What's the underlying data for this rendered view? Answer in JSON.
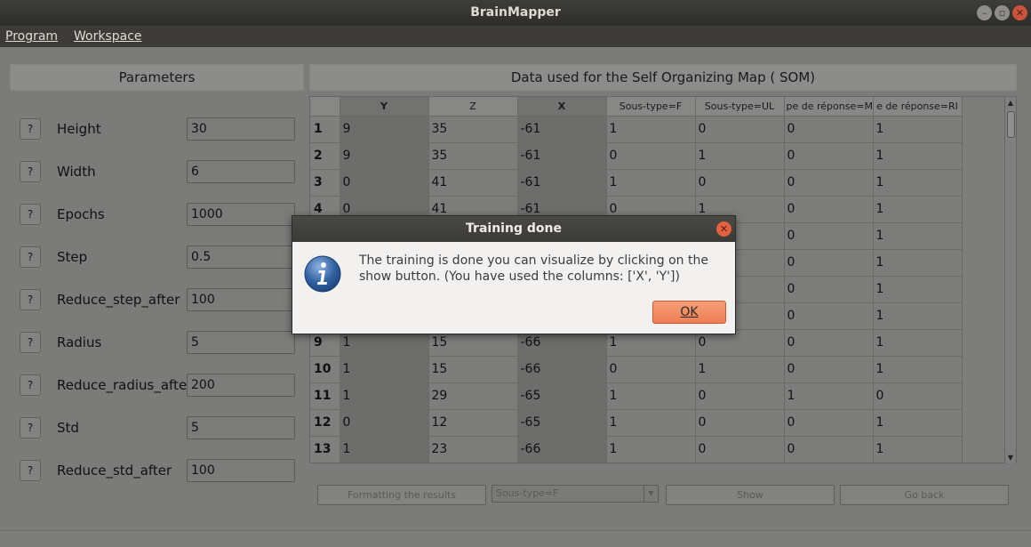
{
  "window": {
    "title": "BrainMapper"
  },
  "menu": {
    "program": "Program",
    "workspace": "Workspace"
  },
  "left_panel": {
    "header": "Parameters",
    "help_label": "?",
    "params": [
      {
        "label": "Height",
        "value": "30"
      },
      {
        "label": "Width",
        "value": "6"
      },
      {
        "label": "Epochs",
        "value": "1000"
      },
      {
        "label": "Step",
        "value": "0.5"
      },
      {
        "label": "Reduce_step_after",
        "value": "100"
      },
      {
        "label": "Radius",
        "value": "5"
      },
      {
        "label": "Reduce_radius_after",
        "value": "200"
      },
      {
        "label": "Std",
        "value": "5"
      },
      {
        "label": "Reduce_std_after",
        "value": "100"
      }
    ]
  },
  "right_panel": {
    "header": "Data used for the Self Organizing Map ( SOM)",
    "columns": [
      "Y",
      "Z",
      "X",
      "Sous-type=F",
      "Sous-type=UL",
      "pe de réponse=M",
      "e de réponse=RI"
    ],
    "rows": [
      {
        "id": "1",
        "cells": [
          "9",
          "35",
          "-61",
          "1",
          "0",
          "0",
          "1"
        ]
      },
      {
        "id": "2",
        "cells": [
          "9",
          "35",
          "-61",
          "0",
          "1",
          "0",
          "1"
        ]
      },
      {
        "id": "3",
        "cells": [
          "0",
          "41",
          "-61",
          "1",
          "0",
          "0",
          "1"
        ]
      },
      {
        "id": "4",
        "cells": [
          "0",
          "41",
          "-61",
          "0",
          "1",
          "0",
          "1"
        ]
      },
      {
        "id": "",
        "cells": [
          "",
          "",
          "",
          "",
          "",
          "0",
          "1"
        ]
      },
      {
        "id": "",
        "cells": [
          "",
          "",
          "",
          "",
          "",
          "0",
          "1"
        ]
      },
      {
        "id": "",
        "cells": [
          "",
          "",
          "",
          "",
          "",
          "0",
          "1"
        ]
      },
      {
        "id": "",
        "cells": [
          "",
          "",
          "",
          "",
          "",
          "0",
          "1"
        ]
      },
      {
        "id": "9",
        "cells": [
          "1",
          "15",
          "-66",
          "1",
          "0",
          "0",
          "1"
        ]
      },
      {
        "id": "10",
        "cells": [
          "1",
          "15",
          "-66",
          "0",
          "1",
          "0",
          "1"
        ]
      },
      {
        "id": "11",
        "cells": [
          "1",
          "29",
          "-65",
          "1",
          "0",
          "1",
          "0"
        ]
      },
      {
        "id": "12",
        "cells": [
          "0",
          "12",
          "-65",
          "1",
          "0",
          "0",
          "1"
        ]
      },
      {
        "id": "13",
        "cells": [
          "1",
          "23",
          "-66",
          "1",
          "0",
          "0",
          "1"
        ]
      }
    ],
    "buttons": {
      "format": "Formatting the results",
      "combo_value": "Sous-type=F",
      "show": "Show",
      "go_back": "Go back"
    }
  },
  "dialog": {
    "title": "Training done",
    "message": "The training is done you can visualize by clicking on the show button. (You have used the columns: ['X', 'Y'])",
    "ok": "OK"
  },
  "colors": {
    "accent": "#ee7f52",
    "close": "#e1623f",
    "info_icon": "#3465a4"
  }
}
